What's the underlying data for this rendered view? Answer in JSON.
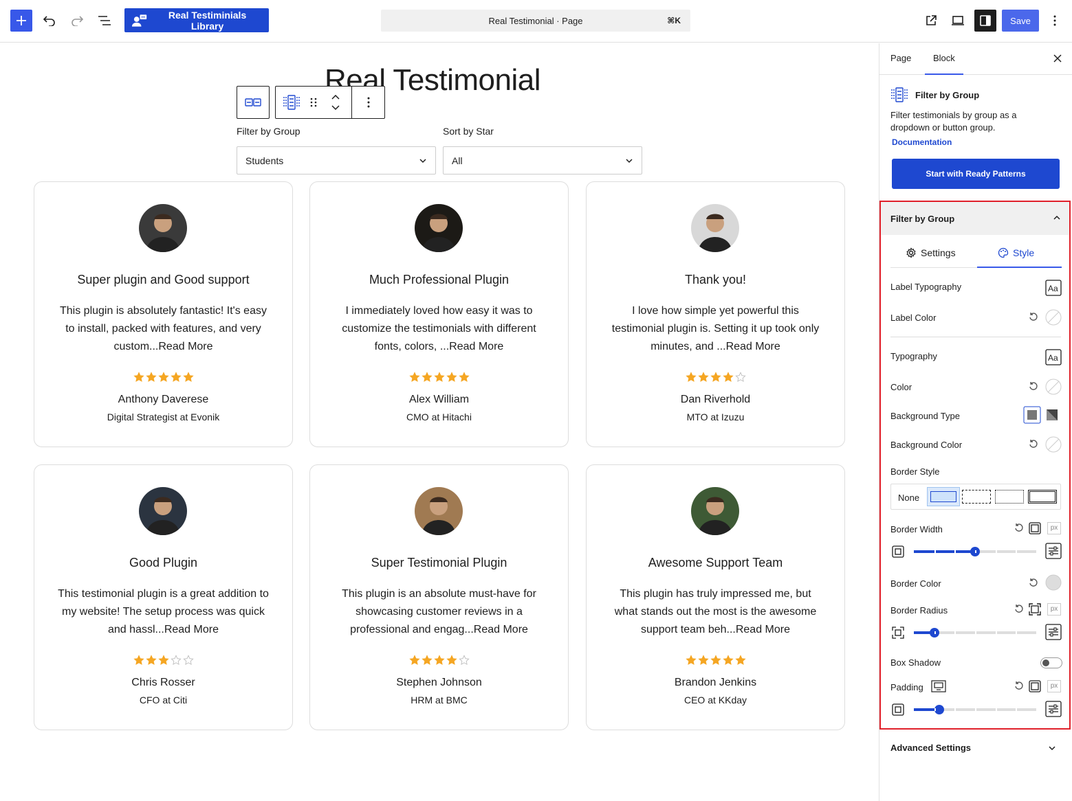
{
  "topbar": {
    "library_label": "Real Testiminials Library",
    "command_title": "Real Testimonial · Page",
    "command_shortcut": "⌘K",
    "save_label": "Save"
  },
  "page": {
    "title": "Real Testimonial",
    "filter_label": "Filter by Group",
    "filter_value": "Students",
    "sort_label": "Sort by Star",
    "sort_value": "All"
  },
  "cards": [
    {
      "title": "Super plugin and Good support",
      "body": "This plugin is absolutely fantastic! It's easy to install, packed with features, and very custom...Read More",
      "rating": 5,
      "name": "Anthony Daverese",
      "role": "Digital Strategist at Evonik",
      "avatar_color": "#3a3a3a"
    },
    {
      "title": "Much Professional Plugin",
      "body": "I immediately loved how easy it was to customize the testimonials with different fonts, colors, ...Read More",
      "rating": 5,
      "name": "Alex William",
      "role": "CMO at Hitachi",
      "avatar_color": "#1c1a16"
    },
    {
      "title": "Thank you!",
      "body": "I love how simple yet powerful this testimonial plugin is. Setting it up took only minutes, and ...Read More",
      "rating": 4,
      "name": "Dan Riverhold",
      "role": "MTO at Izuzu",
      "avatar_color": "#d8d8d8"
    },
    {
      "title": "Good Plugin",
      "body": "This testimonial plugin is a great addition to my website! The setup process was quick and hassl...Read More",
      "rating": 3,
      "name": "Chris Rosser",
      "role": "CFO at Citi",
      "avatar_color": "#2b3440"
    },
    {
      "title": "Super Testimonial Plugin",
      "body": "This plugin is an absolute must-have for showcasing customer reviews in a professional and engag...Read More",
      "rating": 4,
      "name": "Stephen Johnson",
      "role": "HRM at BMC",
      "avatar_color": "#a07a52"
    },
    {
      "title": "Awesome Support Team",
      "body": "This plugin has truly impressed me, but what stands out the most is the awesome support team beh...Read More",
      "rating": 5,
      "name": "Brandon Jenkins",
      "role": "CEO at KKday",
      "avatar_color": "#3e5a35"
    }
  ],
  "sidebar": {
    "tab_page": "Page",
    "tab_block": "Block",
    "block_name": "Filter by Group",
    "block_desc": "Filter testimonials by group as a dropdown or button group.",
    "doc_link": "Documentation",
    "patterns_button": "Start with Ready Patterns",
    "panel_title": "Filter by Group",
    "subtab_settings": "Settings",
    "subtab_style": "Style",
    "label_typography": "Label Typography",
    "label_color": "Label Color",
    "typography": "Typography",
    "color": "Color",
    "background_type": "Background Type",
    "background_color": "Background Color",
    "border_style": "Border Style",
    "border_none": "None",
    "border_width": "Border Width",
    "border_width_value": 0.5,
    "border_color": "Border Color",
    "border_radius": "Border Radius",
    "border_radius_value": 0.17,
    "box_shadow": "Box Shadow",
    "box_shadow_on": false,
    "padding": "Padding",
    "padding_value": 0.21,
    "unit": "px",
    "advanced": "Advanced Settings"
  },
  "colors": {
    "accent": "#1e48d0",
    "wp_blue": "#3858e9",
    "star": "#f5a623",
    "highlight_border": "#e0202a"
  }
}
